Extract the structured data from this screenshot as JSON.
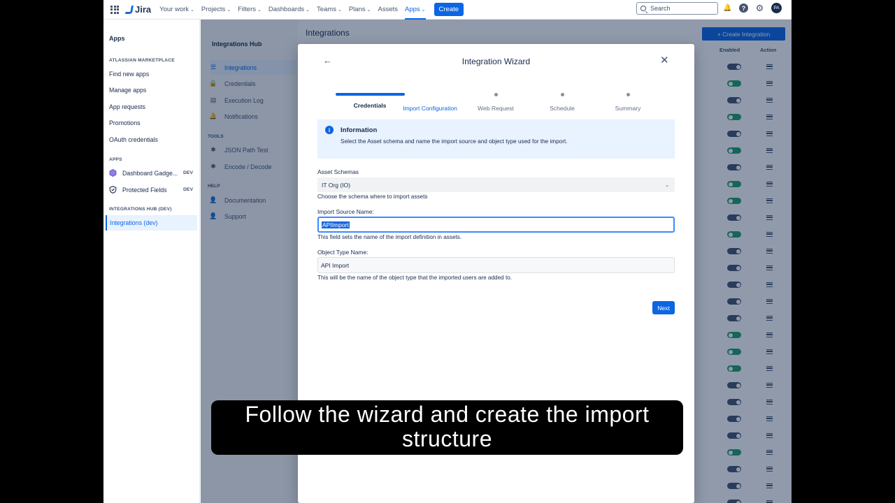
{
  "topnav": {
    "logo": "Jira",
    "items": [
      {
        "label": "Your work"
      },
      {
        "label": "Projects"
      },
      {
        "label": "Filters"
      },
      {
        "label": "Dashboards"
      },
      {
        "label": "Teams"
      },
      {
        "label": "Plans"
      },
      {
        "label": "Assets"
      },
      {
        "label": "Apps",
        "active": true
      }
    ],
    "create_label": "Create",
    "search_placeholder": "Search",
    "avatar_initials": "PA"
  },
  "sidebar": {
    "title": "Apps",
    "marketplace_heading": "ATLASSIAN MARKETPLACE",
    "marketplace_items": [
      "Find new apps",
      "Manage apps",
      "App requests",
      "Promotions",
      "OAuth credentials"
    ],
    "apps_heading": "APPS",
    "apps": [
      {
        "label": "Dashboard Gadge...",
        "badge": "DEV"
      },
      {
        "label": "Protected Fields",
        "badge": "DEV"
      }
    ],
    "hub_heading": "INTEGRATIONS HUB (DEV)",
    "hub_item": "Integrations (dev)"
  },
  "hub": {
    "title": "Integrations Hub",
    "nav": [
      "Integrations",
      "Credentials",
      "Execution Log",
      "Notifications"
    ],
    "tools_heading": "TOOLS",
    "tools": [
      "JSON Path Test",
      "Encode / Decode"
    ],
    "help_heading": "HELP",
    "help": [
      "Documentation",
      "Support"
    ],
    "page_title": "Integrations",
    "create_button": "+ Create Integration",
    "col_enabled": "Enabled",
    "col_action": "Action",
    "rows_enabled": [
      false,
      true,
      false,
      true,
      false,
      true,
      false,
      true,
      true,
      false,
      true,
      false,
      false,
      false,
      false,
      false,
      true,
      true,
      true,
      false,
      false,
      false,
      false,
      true,
      false,
      false,
      false
    ]
  },
  "modal": {
    "title": "Integration Wizard",
    "steps": [
      {
        "label": "Credentials",
        "state": "done"
      },
      {
        "label": "Import Configuration",
        "state": "current"
      },
      {
        "label": "Web Request",
        "state": "todo"
      },
      {
        "label": "Schedule",
        "state": "todo"
      },
      {
        "label": "Summary",
        "state": "todo"
      }
    ],
    "info_heading": "Information",
    "info_text": "Select the Asset schema and name the import source and object type used for the import.",
    "schema_label": "Asset Schemas",
    "schema_value": "IT Org (IO)",
    "schema_help": "Choose the schema where to import assets",
    "source_label": "Import Source Name:",
    "source_value": "APIImport",
    "source_help": "This field sets the name of the import definition in assets.",
    "object_label": "Object Type Name:",
    "object_value": "API Import",
    "object_help": "This will be the name of the object type that the imported users are added to.",
    "next_label": "Next"
  },
  "caption": "Follow the wizard and create the import structure",
  "colors": {
    "primary": "#0c66e4",
    "info_bg": "#e9f2ff",
    "toggle_on": "#22a06b"
  }
}
